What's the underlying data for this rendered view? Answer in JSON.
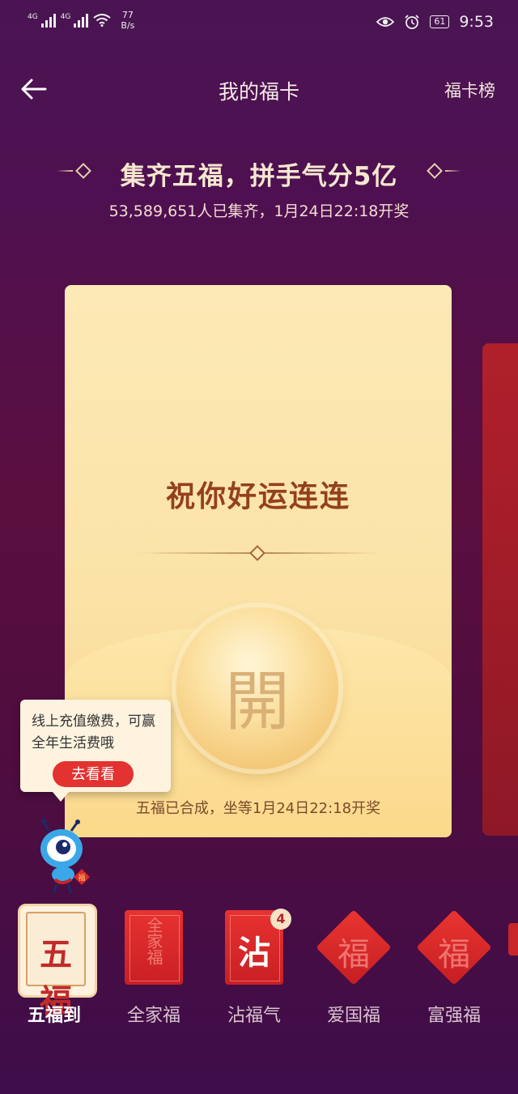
{
  "status_bar": {
    "net1": "4G",
    "net2": "4G",
    "speed_value": "77",
    "speed_unit": "B/s",
    "battery": "61",
    "time": "9:53"
  },
  "nav": {
    "title": "我的福卡",
    "right_link": "福卡榜"
  },
  "header": {
    "headline": "集齐五福，拼手气分5亿",
    "subline": "53,589,651人已集齐，1月24日22:18开奖"
  },
  "card": {
    "blessing": "祝你好运连连",
    "open_char": "開",
    "note": "五福已合成，坐等1月24日22:18开奖"
  },
  "tooltip": {
    "text": "线上充值缴费，可赢全年生活费哦",
    "button": "去看看"
  },
  "tabs": [
    {
      "label": "五福到",
      "card_text": "五福",
      "active": true
    },
    {
      "label": "全家福",
      "card_text": "全家福"
    },
    {
      "label": "沾福气",
      "card_text": "沾",
      "badge": "4"
    },
    {
      "label": "爱国福",
      "card_text": "福"
    },
    {
      "label": "富强福",
      "card_text": "福"
    }
  ],
  "colors": {
    "accent_red": "#e3322f",
    "gold": "#fbe3a7"
  }
}
